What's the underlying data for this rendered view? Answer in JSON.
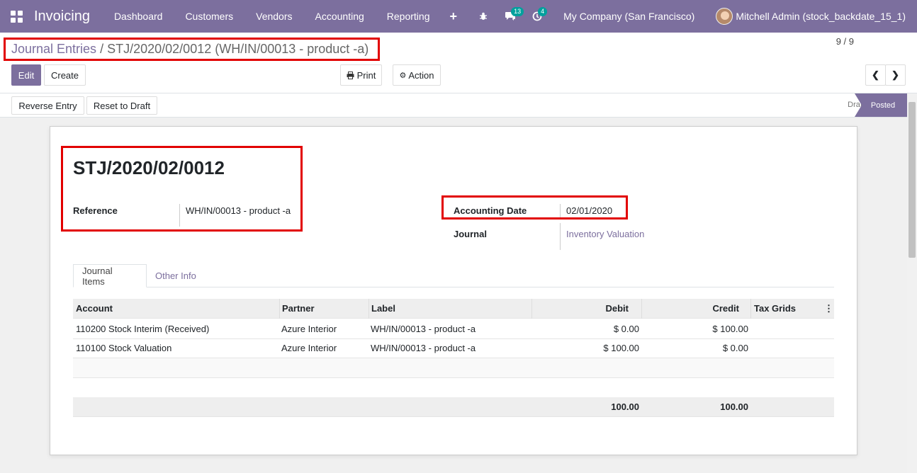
{
  "nav": {
    "brand": "Invoicing",
    "menu": [
      "Dashboard",
      "Customers",
      "Vendors",
      "Accounting",
      "Reporting"
    ],
    "plus": "+",
    "messages_count": "13",
    "activities_count": "4",
    "company": "My Company (San Francisco)",
    "user": "Mitchell Admin (stock_backdate_15_1)"
  },
  "breadcrumb": {
    "parent": "Journal Entries",
    "separator": "/",
    "current": "STJ/2020/02/0012 (WH/IN/00013 - product -a)"
  },
  "buttons": {
    "edit": "Edit",
    "create": "Create",
    "print": "Print",
    "action": "Action",
    "reverse": "Reverse Entry",
    "reset": "Reset to Draft"
  },
  "pager": {
    "value": "9 / 9"
  },
  "status": {
    "draft": "Draft",
    "posted": "Posted"
  },
  "entry": {
    "name": "STJ/2020/02/0012",
    "reference_label": "Reference",
    "reference": "WH/IN/00013 - product -a",
    "date_label": "Accounting Date",
    "date": "02/01/2020",
    "journal_label": "Journal",
    "journal": "Inventory Valuation"
  },
  "tabs": [
    "Journal Items",
    "Other Info"
  ],
  "table": {
    "headers": [
      "Account",
      "Partner",
      "Label",
      "Debit",
      "Credit",
      "Tax Grids"
    ],
    "rows": [
      [
        "110200 Stock Interim (Received)",
        "Azure Interior",
        "WH/IN/00013 - product -a",
        "$ 0.00",
        "$ 100.00",
        ""
      ],
      [
        "110100 Stock Valuation",
        "Azure Interior",
        "WH/IN/00013 - product -a",
        "$ 100.00",
        "$ 0.00",
        ""
      ]
    ],
    "total_debit": "100.00",
    "total_credit": "100.00"
  },
  "colors": {
    "brand": "#7c6f9e",
    "highlight": "#e20000",
    "badge": "#00a09d"
  }
}
